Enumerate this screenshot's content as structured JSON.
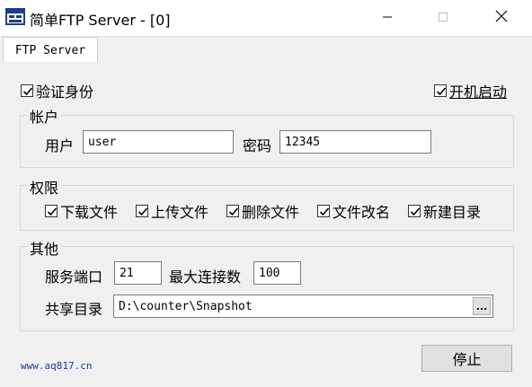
{
  "window": {
    "title": "简单FTP Server - [0]",
    "icon": "ftp-app-icon",
    "controls": [
      "minimize-icon",
      "maximize-icon",
      "close-icon"
    ]
  },
  "tabs": [
    {
      "label": "FTP Server",
      "active": true
    }
  ],
  "options": {
    "verify_identity": {
      "label": "验证身份",
      "checked": true
    },
    "auto_start": {
      "label": "开机启动",
      "checked": true
    }
  },
  "account": {
    "legend": "帐户",
    "user_label": "用户",
    "user_value": "user",
    "password_label": "密码",
    "password_value": "12345"
  },
  "permissions": {
    "legend": "权限",
    "items": [
      {
        "label": "下载文件",
        "checked": true
      },
      {
        "label": "上传文件",
        "checked": true
      },
      {
        "label": "删除文件",
        "checked": true
      },
      {
        "label": "文件改名",
        "checked": true
      },
      {
        "label": "新建目录",
        "checked": true
      }
    ]
  },
  "other": {
    "legend": "其他",
    "port_label": "服务端口",
    "port_value": "21",
    "max_conn_label": "最大连接数",
    "max_conn_value": "100",
    "share_dir_label": "共享目录",
    "share_dir_value": "D:\\counter\\Snapshot",
    "browse_label": "..."
  },
  "footer": {
    "link_text": "www.aq817.cn",
    "link_color": "#1a3a9e",
    "stop_button_label": "停止"
  }
}
